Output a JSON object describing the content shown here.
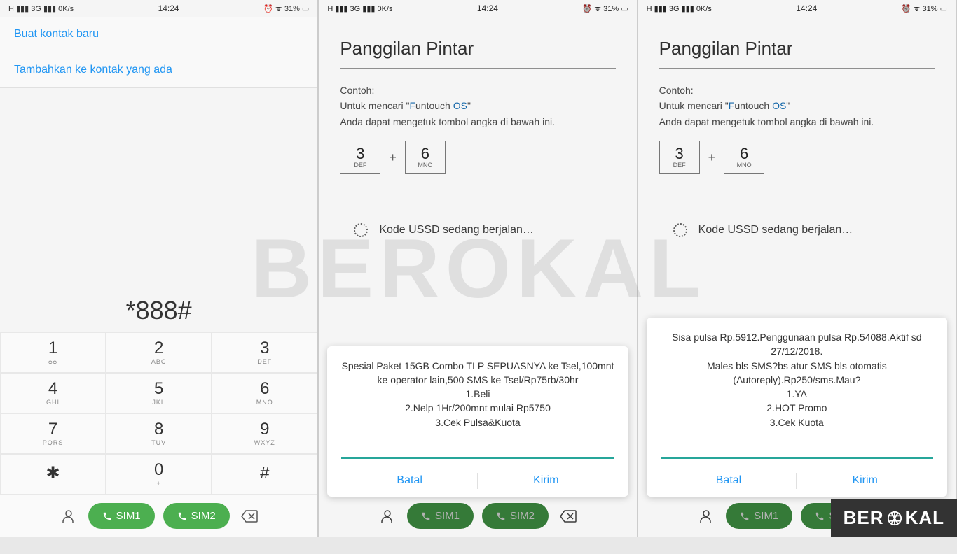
{
  "status": {
    "left": "H ▮▮▮ 3G ▮▮▮ 0K/s",
    "time": "14:24",
    "right": "⏰ ᯤ 31% ▭"
  },
  "phone1": {
    "opt1": "Buat kontak baru",
    "opt2": "Tambahkan ke kontak yang ada",
    "dialed": "*888#",
    "sim1": "SIM1",
    "sim2": "SIM2"
  },
  "keys": [
    {
      "d": "1",
      "l": "ᴑᴑ"
    },
    {
      "d": "2",
      "l": "ABC"
    },
    {
      "d": "3",
      "l": "DEF"
    },
    {
      "d": "4",
      "l": "GHI"
    },
    {
      "d": "5",
      "l": "JKL"
    },
    {
      "d": "6",
      "l": "MNO"
    },
    {
      "d": "7",
      "l": "PQRS"
    },
    {
      "d": "8",
      "l": "TUV"
    },
    {
      "d": "9",
      "l": "WXYZ"
    },
    {
      "d": "✱",
      "l": ""
    },
    {
      "d": "0",
      "l": "+"
    },
    {
      "d": "#",
      "l": ""
    }
  ],
  "smart": {
    "title": "Panggilan Pintar",
    "example_label": "Contoh:",
    "example_prefix": "Untuk mencari \"",
    "example_f": "F",
    "example_mid": "untouch ",
    "example_os": "OS",
    "example_close": "\"",
    "example_line2": "Anda dapat mengetuk tombol angka di bawah ini.",
    "key3": {
      "d": "3",
      "l": "DEF"
    },
    "key6": {
      "d": "6",
      "l": "MNO"
    },
    "running": "Kode USSD sedang berjalan…"
  },
  "dialog2": {
    "text": "Spesial Paket 15GB Combo TLP SEPUASNYA ke Tsel,100mnt ke operator lain,500 SMS ke Tsel/Rp75rb/30hr\n1.Beli\n2.Nelp 1Hr/200mnt mulai Rp5750\n3.Cek Pulsa&Kuota",
    "cancel": "Batal",
    "send": "Kirim"
  },
  "dialog3": {
    "text": "Sisa pulsa Rp.5912.Penggunaan pulsa Rp.54088.Aktif sd 27/12/2018.\nMales bls SMS?bs atur SMS bls otomatis (Autoreply).Rp250/sms.Mau?\n1.YA\n2.HOT Promo\n3.Cek Kuota",
    "cancel": "Batal",
    "send": "Kirim"
  },
  "watermark": "BEROKAL",
  "brand": "BER",
  "brand2": "KAL"
}
